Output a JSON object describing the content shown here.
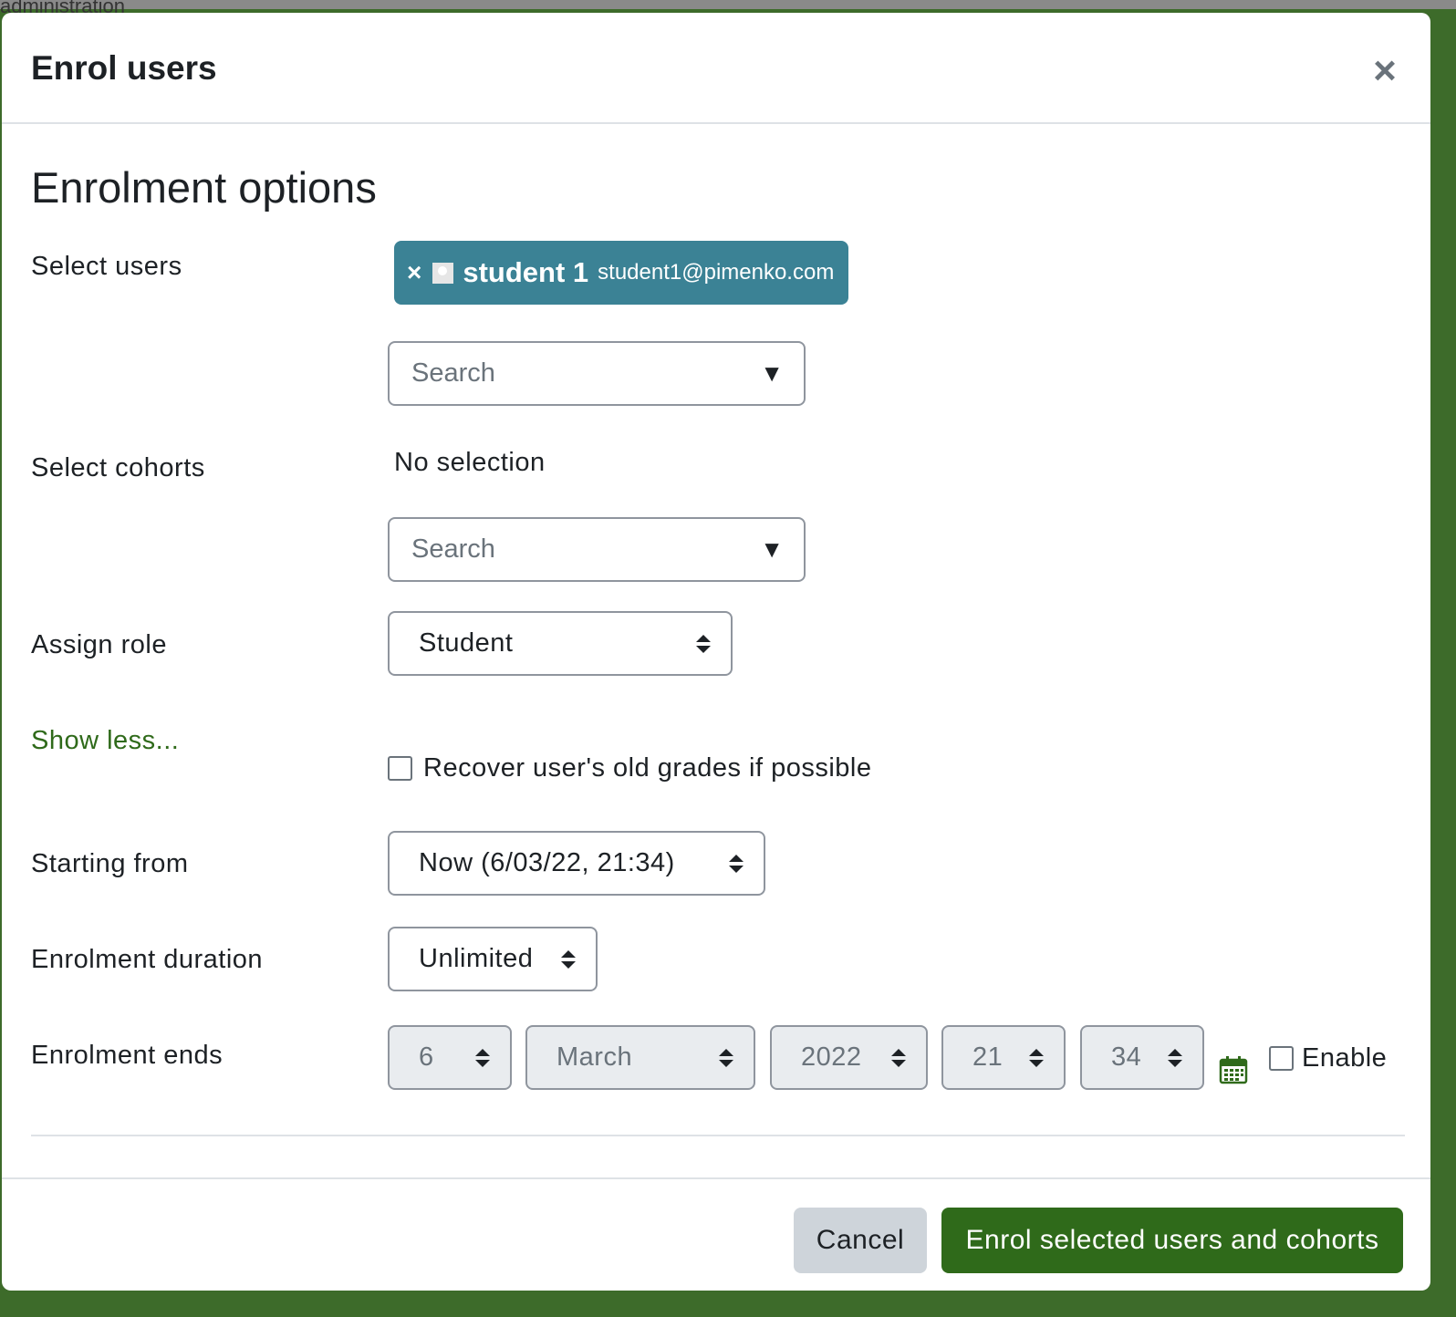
{
  "background_partial_text": "administration",
  "modal": {
    "title": "Enrol users",
    "close_symbol": "×"
  },
  "section_title": "Enrolment options",
  "select_users": {
    "label": "Select users",
    "selected": [
      {
        "remove_symbol": "×",
        "name": "student 1",
        "email": "student1@pimenko.com"
      }
    ],
    "search_placeholder": "Search",
    "dropdown_symbol": "▼"
  },
  "select_cohorts": {
    "label": "Select cohorts",
    "status": "No selection",
    "search_placeholder": "Search",
    "dropdown_symbol": "▼"
  },
  "assign_role": {
    "label": "Assign role",
    "value": "Student"
  },
  "show_less_link": "Show less...",
  "recover_grades": {
    "label": "Recover user's old grades if possible",
    "checked": false
  },
  "starting_from": {
    "label": "Starting from",
    "value": "Now (6/03/22, 21:34)"
  },
  "enrolment_duration": {
    "label": "Enrolment duration",
    "value": "Unlimited"
  },
  "enrolment_ends": {
    "label": "Enrolment ends",
    "day": "6",
    "month": "March",
    "year": "2022",
    "hour": "21",
    "minute": "34",
    "enable_label": "Enable",
    "enabled": false
  },
  "footer": {
    "cancel_label": "Cancel",
    "submit_label": "Enrol selected users and cohorts"
  },
  "colors": {
    "chip_bg": "#3b8295",
    "primary": "#2f6a1a",
    "secondary_button": "#ced4da"
  }
}
